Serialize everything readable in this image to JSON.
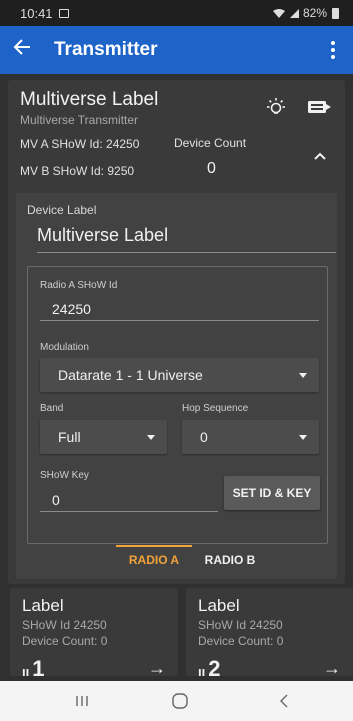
{
  "status_bar": {
    "time": "10:41",
    "battery": "82%"
  },
  "app_bar": {
    "title": "Transmitter"
  },
  "transmitter": {
    "name": "Multiverse Label",
    "subtitle": "Multiverse Transmitter",
    "mv_a": "MV A SHoW Id: 24250",
    "mv_b": "MV B SHoW Id: 9250",
    "device_count_label": "Device Count",
    "device_count": "0"
  },
  "form": {
    "device_label_label": "Device Label",
    "device_label_value": "Multiverse Label",
    "radio_show_id_label": "Radio A SHoW Id",
    "radio_show_id_value": "24250",
    "modulation_label": "Modulation",
    "modulation_value": "Datarate 1 - 1 Universe",
    "band_label": "Band",
    "band_value": "Full",
    "hop_label": "Hop Sequence",
    "hop_value": "0",
    "show_key_label": "SHoW Key",
    "show_key_value": "0",
    "set_button": "SET ID & KEY"
  },
  "tabs": [
    {
      "label": "RADIO A",
      "active": true
    },
    {
      "label": "RADIO B",
      "active": false
    }
  ],
  "universes": [
    {
      "label": "Label",
      "show_id": "SHoW Id 24250",
      "device_count": "Device Count: 0",
      "number": "1"
    },
    {
      "label": "Label",
      "show_id": "SHoW Id 24250",
      "device_count": "Device Count: 0",
      "number": "2"
    }
  ],
  "colors": {
    "app_bar": "#1e63c8",
    "accent": "#f2a33a",
    "background": "#303030",
    "card": "#3a3a3a"
  },
  "icons": [
    "back-arrow-icon",
    "more-vert-icon",
    "lightbulb-icon",
    "rdm-icon",
    "chevron-up-icon",
    "arrow-right-icon"
  ]
}
